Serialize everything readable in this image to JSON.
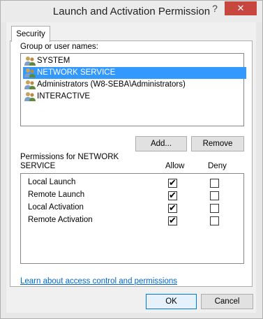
{
  "window": {
    "title": "Launch and Activation Permission",
    "help_glyph": "?",
    "close_glyph": "✕"
  },
  "tab": {
    "label": "Security"
  },
  "groups": {
    "label": "Group or user names:",
    "items": [
      {
        "name": "SYSTEM",
        "selected": false
      },
      {
        "name": "NETWORK SERVICE",
        "selected": true
      },
      {
        "name": "Administrators (W8-SEBA\\Administrators)",
        "selected": false
      },
      {
        "name": "INTERACTIVE",
        "selected": false
      }
    ]
  },
  "buttons": {
    "add": "Add...",
    "remove": "Remove",
    "ok": "OK",
    "cancel": "Cancel"
  },
  "permissions": {
    "label_line1": "Permissions for NETWORK",
    "label_line2": "SERVICE",
    "allow_header": "Allow",
    "deny_header": "Deny",
    "rows": [
      {
        "name": "Local Launch",
        "allow": true,
        "deny": false
      },
      {
        "name": "Remote Launch",
        "allow": true,
        "deny": false
      },
      {
        "name": "Local Activation",
        "allow": true,
        "deny": false
      },
      {
        "name": "Remote Activation",
        "allow": true,
        "deny": false
      }
    ]
  },
  "link": "Learn about access control and permissions",
  "check_glyph": "✔"
}
